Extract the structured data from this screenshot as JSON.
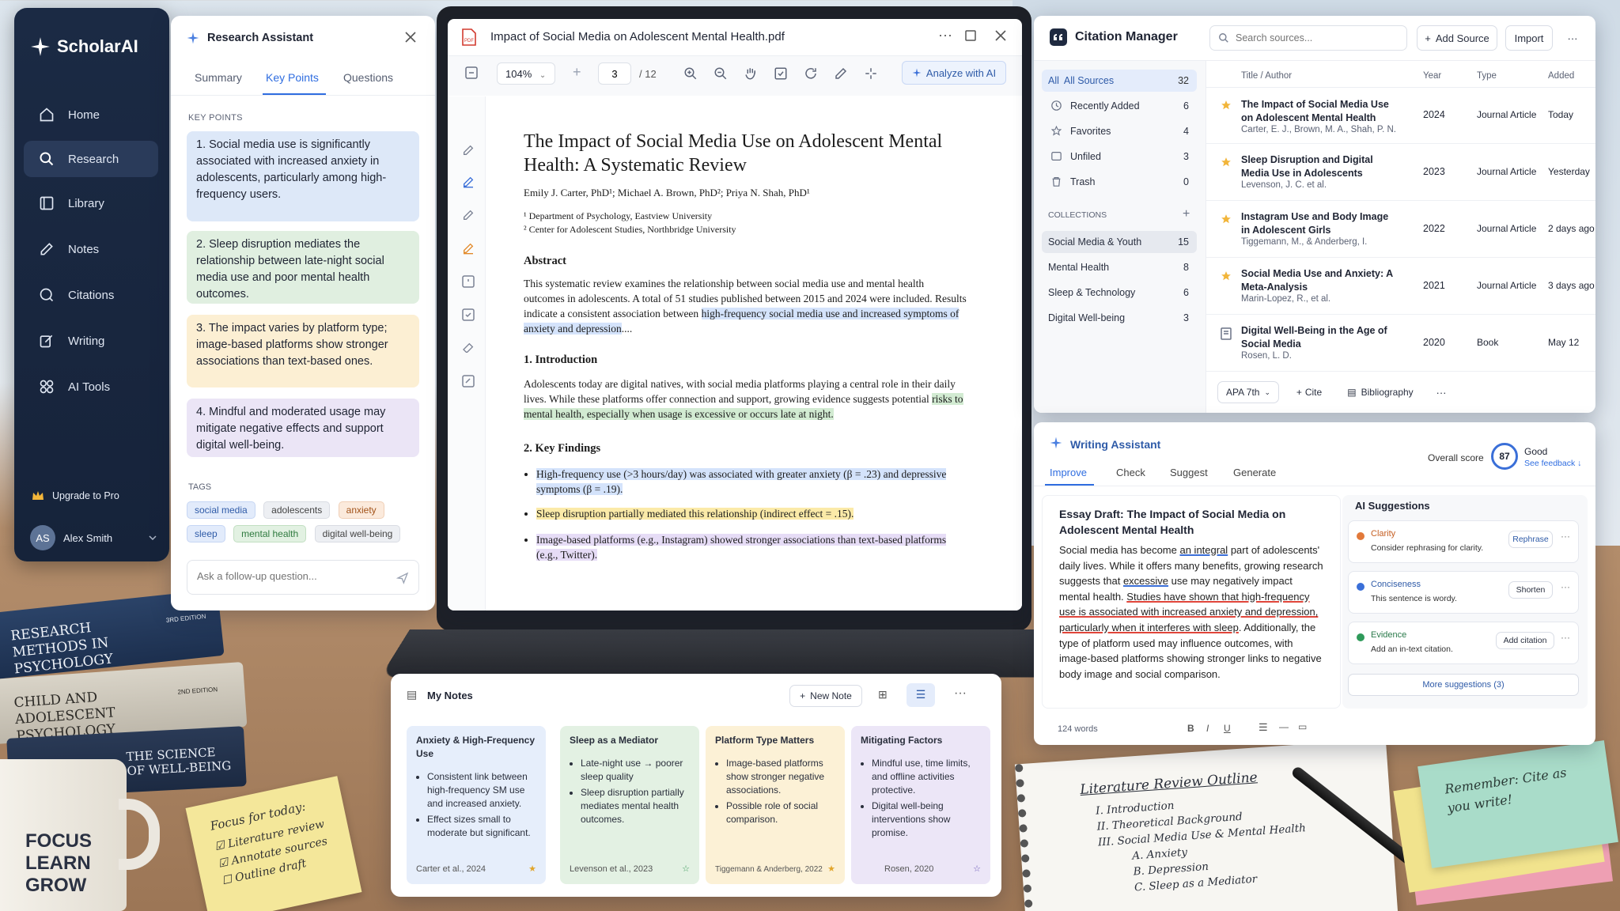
{
  "sidebar": {
    "brand": "ScholarAI",
    "items": [
      {
        "label": "Home"
      },
      {
        "label": "Research"
      },
      {
        "label": "Library"
      },
      {
        "label": "Notes"
      },
      {
        "label": "Citations"
      },
      {
        "label": "Writing"
      },
      {
        "label": "AI Tools"
      }
    ],
    "upgrade": "Upgrade to Pro",
    "user": {
      "initials": "AS",
      "name": "Alex Smith"
    }
  },
  "assistant": {
    "title": "Research Assistant",
    "tabs": [
      "Summary",
      "Key Points",
      "Questions"
    ],
    "section": "KEY POINTS",
    "points": [
      {
        "num": "1.",
        "text": "Social media use is significantly associated with increased anxiety in adolescents, particularly among high-frequency users."
      },
      {
        "num": "2.",
        "text": "Sleep disruption mediates the relationship between late-night social media use and poor mental health outcomes."
      },
      {
        "num": "3.",
        "text": "The impact varies by platform type; image-based platforms show stronger associations than text-based ones."
      },
      {
        "num": "4.",
        "text": "Mindful and moderated usage may mitigate negative effects and support digital well-being."
      }
    ],
    "tags_label": "TAGS",
    "tags": [
      "social media",
      "adolescents",
      "anxiety",
      "sleep",
      "mental health",
      "digital well-being"
    ],
    "ask_placeholder": "Ask a follow-up question..."
  },
  "pdf": {
    "filename": "Impact of Social Media on Adolescent Mental Health.pdf",
    "zoom": "104%",
    "page": "3",
    "total": "/ 12",
    "analyze": "Analyze with AI",
    "title": "The Impact of Social Media Use on Adolescent Mental Health: A Systematic Review",
    "authors": "Emily J. Carter, PhD¹; Michael A. Brown, PhD²; Priya N. Shah, PhD¹",
    "aff1": "¹ Department of Psychology, Eastview University",
    "aff2": "² Center for Adolescent Studies, Northbridge University",
    "abstract_h": "Abstract",
    "abstract_a": "This systematic review examines the relationship between social media use and mental health outcomes in adolescents. A total of 51 studies published between 2015 and 2024 were included. Results indicate a consistent association between ",
    "abstract_hl": "high-frequency social media use and increased symptoms of anxiety and depression",
    "abstract_end": "....",
    "intro_h": "1. Introduction",
    "intro_a": "Adolescents today are digital natives, with social media platforms playing a central role in their daily lives. While these platforms offer connection and support, growing evidence suggests potential ",
    "intro_hl": "risks to mental health, especially when usage is excessive or occurs late at night.",
    "find_h": "2. Key Findings",
    "findings": [
      "High-frequency use (>3 hours/day) was associated with greater anxiety (β = .23) and depressive symptoms (β = .19).",
      "Sleep disruption partially mediated this relationship (indirect effect = .15).",
      "Image-based platforms (e.g., Instagram) showed stronger associations than text-based platforms (e.g., Twitter)."
    ]
  },
  "citation": {
    "title": "Citation Manager",
    "search_placeholder": "Search sources...",
    "add": "Add Source",
    "import": "Import",
    "library": [
      {
        "label": "All Sources",
        "count": "32"
      },
      {
        "label": "Recently Added",
        "count": "6"
      },
      {
        "label": "Favorites",
        "count": "4"
      },
      {
        "label": "Unfiled",
        "count": "3"
      },
      {
        "label": "Trash",
        "count": "0"
      }
    ],
    "all_prefix": "All",
    "collections_label": "COLLECTIONS",
    "collections": [
      {
        "label": "Social Media & Youth",
        "count": "15"
      },
      {
        "label": "Mental Health",
        "count": "8"
      },
      {
        "label": "Sleep & Technology",
        "count": "6"
      },
      {
        "label": "Digital Well-being",
        "count": "3"
      }
    ],
    "columns": [
      "Title / Author",
      "Year",
      "Type",
      "Added"
    ],
    "rows": [
      {
        "title": "The Impact of Social Media Use on Adolescent Mental Health",
        "author": "Carter, E. J., Brown, M. A., Shah, P. N.",
        "year": "2024",
        "type": "Journal Article",
        "added": "Today"
      },
      {
        "title": "Sleep Disruption and Digital Media Use in Adolescents",
        "author": "Levenson, J. C. et al.",
        "year": "2023",
        "type": "Journal Article",
        "added": "Yesterday"
      },
      {
        "title": "Instagram Use and Body Image in Adolescent Girls",
        "author": "Tiggemann, M., & Anderberg, I.",
        "year": "2022",
        "type": "Journal Article",
        "added": "2 days ago"
      },
      {
        "title": "Social Media Use and Anxiety: A Meta-Analysis",
        "author": "Marin-Lopez, R., et al.",
        "year": "2021",
        "type": "Journal Article",
        "added": "3 days ago"
      },
      {
        "title": "Digital Well-Being in the Age of Social Media",
        "author": "Rosen, L. D.",
        "year": "2020",
        "type": "Book",
        "added": "May 12"
      }
    ],
    "style": "APA 7th",
    "cite": "Cite",
    "bibliography": "Bibliography"
  },
  "writing": {
    "title": "Writing Assistant",
    "tabs": [
      "Improve",
      "Check",
      "Suggest",
      "Generate"
    ],
    "score_label": "Overall score",
    "score": "87",
    "score_word": "Good",
    "feedback": "See feedback ↓",
    "essay_title": "Essay Draft: The Impact of Social Media on Adolescent Mental Health",
    "p1": "Social media has become ",
    "u1": "an integral",
    "p2": " part of adolescents' daily lives. While it offers many benefits, growing research suggests that ",
    "u2": "excessive",
    "p3": " use may negatively impact mental health. ",
    "u3": "Studies have shown that high-frequency use is associated with increased anxiety and depression, particularly when it interferes with sleep",
    "p4": ". Additionally, the type of platform used may influence outcomes, with image-based platforms showing stronger links to negative body image and social comparison.",
    "words": "124 words",
    "ai_label": "AI Suggestions",
    "suggestions": [
      {
        "name": "Clarity",
        "desc": "Consider rephrasing for clarity.",
        "action": "Rephrase",
        "color": "#e2793a"
      },
      {
        "name": "Conciseness",
        "desc": "This sentence is wordy.",
        "action": "Shorten",
        "color": "#3a6fd8"
      },
      {
        "name": "Evidence",
        "desc": "Add an in-text citation.",
        "action": "Add citation",
        "color": "#2f9a5a"
      }
    ],
    "more": "More suggestions (3)"
  },
  "notes": {
    "title": "My Notes",
    "new_note": "New Note",
    "cards": [
      {
        "title": "Anxiety & High-Frequency Use",
        "bullets": [
          "Consistent link between high-frequency SM use and increased anxiety.",
          "Effect sizes small to moderate but significant."
        ],
        "source": "Carter et al., 2024",
        "bg": "#e6eefb"
      },
      {
        "title": "Sleep as a Mediator",
        "bullets": [
          "Late-night use → poorer sleep quality",
          "Sleep disruption partially mediates mental health outcomes."
        ],
        "source": "Levenson et al., 2023",
        "bg": "#e3f1e3"
      },
      {
        "title": "Platform Type Matters",
        "bullets": [
          "Image-based platforms show stronger negative associations.",
          "Possible role of social comparison."
        ],
        "source": "Tiggemann & Anderberg, 2022",
        "bg": "#fcf1d6"
      },
      {
        "title": "Mitigating Factors",
        "bullets": [
          "Mindful use, time limits, and offline activities protective.",
          "Digital well-being interventions show promise."
        ],
        "source": "Rosen, 2020",
        "bg": "#ece6f7"
      }
    ]
  },
  "desk": {
    "books": [
      {
        "title": "RESEARCH METHODS IN PSYCHOLOGY",
        "edition": "3RD EDITION"
      },
      {
        "title": "CHILD AND ADOLESCENT PSYCHOLOGY",
        "edition": "2ND EDITION"
      },
      {
        "title": "THE SCIENCE OF WELL-BEING"
      }
    ],
    "mug": [
      "FOCUS",
      "LEARN",
      "GROW"
    ],
    "sticky": {
      "title": "Focus for today:",
      "items": [
        "Literature review",
        "Annotate sources",
        "Outline draft"
      ]
    },
    "outline": {
      "title": "Literature Review Outline",
      "lines": [
        "I. Introduction",
        "II. Theoretical Background",
        "III. Social Media Use & Mental Health",
        "A. Anxiety",
        "B. Depression",
        "C. Sleep as a Mediator"
      ]
    },
    "reminder": "Remember: Cite as you write!"
  }
}
